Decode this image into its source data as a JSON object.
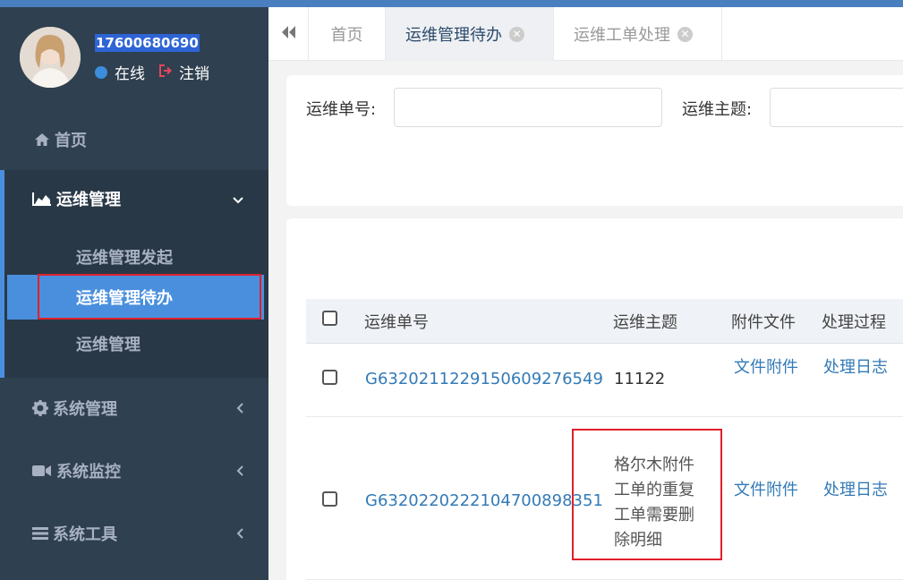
{
  "user": {
    "phone": "17600680690",
    "status": "在线",
    "logout": "注销"
  },
  "sidebar": {
    "home": "首页",
    "ops": "运维管理",
    "ops_sub": [
      "运维管理发起",
      "运维管理待办",
      "运维管理"
    ],
    "system": "系统管理",
    "monitor": "系统监控",
    "tools": "系统工具"
  },
  "tabs": [
    {
      "label": "首页"
    },
    {
      "label": "运维管理待办"
    },
    {
      "label": "运维工单处理"
    }
  ],
  "search": {
    "order_no_label": "运维单号:",
    "subject_label": "运维主题:"
  },
  "table": {
    "headers": [
      "运维单号",
      "运维主题",
      "附件文件",
      "处理过程"
    ],
    "rows": [
      {
        "order_no": "G6320211229150609276549",
        "subject": "11122",
        "attach": "文件附件",
        "process": "处理日志"
      },
      {
        "order_no": "G6320220222104700898351",
        "subject": "格尔木附件工单的重复工单需要删除明细",
        "attach": "文件附件",
        "process": "处理日志"
      }
    ]
  },
  "colors": {
    "sidebar_bg": "#2f4050",
    "accent": "#4a8fde",
    "link": "#337ab7",
    "highlight_box": "#e0202a"
  }
}
